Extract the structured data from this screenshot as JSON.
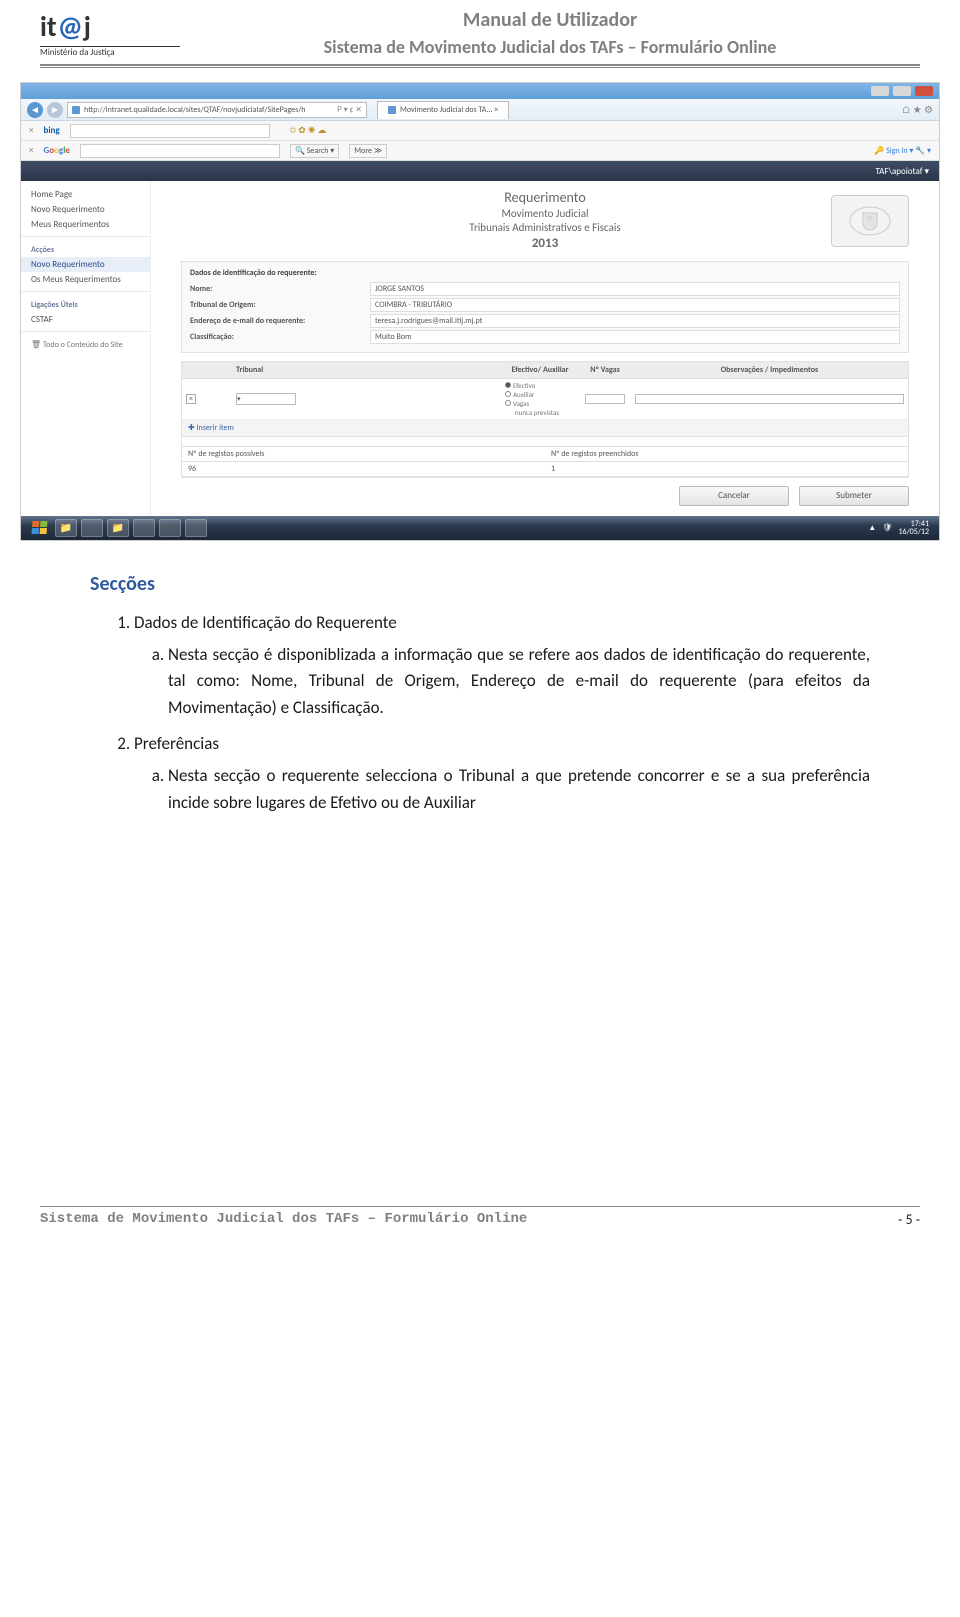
{
  "header": {
    "logo_main_prefix": "it",
    "logo_main_at": "@",
    "logo_main_suffix": "j",
    "logo_sub": "Ministério da Justiça",
    "title1": "Manual de Utilizador",
    "title2": "Sistema de Movimento Judicial dos TAFs – Formulário Online"
  },
  "screenshot": {
    "url": "http://intranet.qualidade.local/sites/QTAF/novjudicialaf/SitePages/h",
    "url_suffix": "𝖯 ▾ ¢ ✕",
    "tab_title": "Movimento Judicial dos TA... ×",
    "bing_label": "bing",
    "bing_icons": "☼  ✿  ✺  ☁",
    "google_label": "Google",
    "google_search_btn": "🔍 Search ▾",
    "google_more_btn": "More ≫",
    "google_signin": "🔑 Sign In ▾ 🔧 ▾",
    "sp_user": "TAF\\apoiotaf ▾",
    "sidebar": {
      "home": "Home Page",
      "novo": "Novo Requerimento",
      "meus": "Meus Requerimentos",
      "accoes_hdr": "Acções",
      "novo2": "Novo Requerimento",
      "osmeus": "Os Meus Requerimentos",
      "ligacoes_hdr": "Ligações Úteis",
      "cstaf": "CSTAF",
      "recycle": "🗑 Todo o Conteúdo do Site"
    },
    "req_header": {
      "line1": "Requerimento",
      "line2": "Movimento Judicial",
      "line3": "Tribunais Administrativos e Fiscais",
      "line4": "2013"
    },
    "form_section": {
      "title": "Dados de identificação do requerente:",
      "nome_lbl": "Nome:",
      "nome_val": "JORGE SANTOS",
      "trib_lbl": "Tribunal de Origem:",
      "trib_val": "COIMBRA - TRIBUTÁRIO",
      "email_lbl": "Endereço de e-mail do requerente:",
      "email_val": "teresa.j.rodrigues@mail.itij.mj.pt",
      "class_lbl": "Classificação:",
      "class_val": "Muito Bom"
    },
    "grid": {
      "col_trib": "Tribunal",
      "col_ef": "Efectivo/ Auxiliar",
      "col_vag": "Nº Vagas",
      "col_obs": "Observações / Impedimentos",
      "radio_efectivo": "Efectivo",
      "radio_aux": "Auxiliar",
      "radio_vagas": "Vagas",
      "radio_nunca": "nunca previstas",
      "inserir": "✚ Inserir item",
      "reg_poss_lbl": "Nº de registos possíveis",
      "reg_poss_val": "96",
      "reg_preen_lbl": "Nº de registos preenchidos",
      "reg_preen_val": "1"
    },
    "btn_cancel": "Cancelar",
    "btn_submit": "Submeter",
    "taskbar": {
      "icons": [
        "📁",
        "🌐",
        "📁",
        "✉",
        "📝",
        "🖥"
      ],
      "time": "17:41",
      "date": "16/05/12"
    }
  },
  "doc": {
    "section_title": "Secções",
    "item1": "Dados de Identificação do Requerente",
    "item1a": "Nesta secção é disponiblizada a informação que se refere aos dados de identificação do requerente, tal como: Nome, Tribunal de Origem, Endereço de e-mail do requerente (para efeitos da Movimentação) e Classificação.",
    "item2": "Preferências",
    "item2a": "Nesta secção o requerente selecciona o Tribunal a que pretende concorrer e se a sua preferência incide sobre lugares de Efetivo ou de Auxiliar"
  },
  "footer": {
    "left": "Sistema de Movimento Judicial dos TAFs – Formulário Online",
    "right": "- 5 -"
  }
}
